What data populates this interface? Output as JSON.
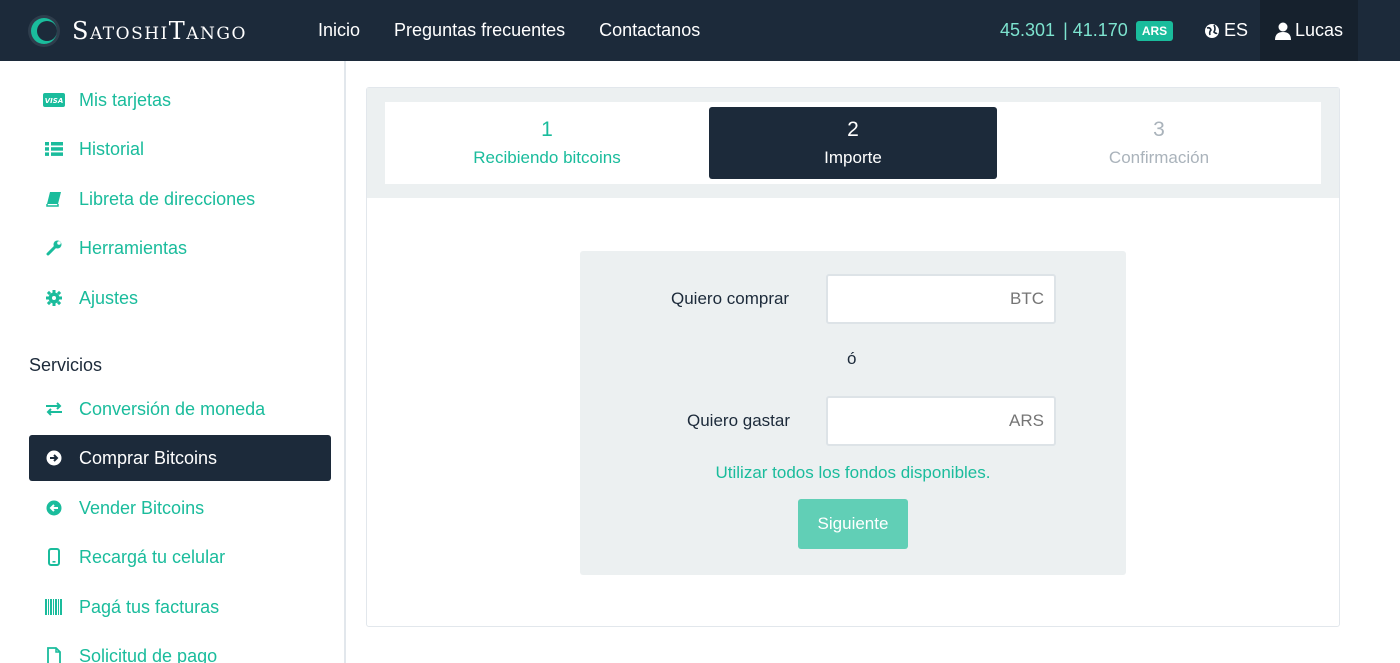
{
  "header": {
    "brand": "SatoshiTango",
    "nav": [
      "Inicio",
      "Preguntas frecuentes",
      "Contactanos"
    ],
    "rate_buy": "45.301",
    "rate_sep": "|",
    "rate_sell": "41.170",
    "currency_badge": "ARS",
    "language": "ES",
    "user": "Lucas"
  },
  "sidebar": {
    "items_top": [
      {
        "label": "Mis tarjetas",
        "icon": "visa-card-icon"
      },
      {
        "label": "Historial",
        "icon": "list-icon"
      },
      {
        "label": "Libreta de direcciones",
        "icon": "book-icon"
      },
      {
        "label": "Herramientas",
        "icon": "wrench-icon"
      },
      {
        "label": "Ajustes",
        "icon": "gear-icon"
      }
    ],
    "services_heading": "Servicios",
    "items_services": [
      {
        "label": "Conversión de moneda",
        "icon": "exchange-icon"
      },
      {
        "label": "Comprar Bitcoins",
        "icon": "arrow-right-circle-icon",
        "active": true
      },
      {
        "label": "Vender Bitcoins",
        "icon": "arrow-left-circle-icon"
      },
      {
        "label": "Recargá tu celular",
        "icon": "mobile-icon"
      },
      {
        "label": "Pagá tus facturas",
        "icon": "barcode-icon"
      },
      {
        "label": "Solicitud de pago",
        "icon": "document-icon"
      }
    ]
  },
  "steps": [
    {
      "num": "1",
      "label": "Recibiendo bitcoins",
      "state": "done"
    },
    {
      "num": "2",
      "label": "Importe",
      "state": "active"
    },
    {
      "num": "3",
      "label": "Confirmación",
      "state": "pending"
    }
  ],
  "form": {
    "buy_label": "Quiero comprar",
    "buy_placeholder": "BTC",
    "or_text": "ó",
    "spend_label": "Quiero gastar",
    "spend_placeholder": "ARS",
    "use_all_link": "Utilizar todos los fondos disponibles.",
    "next_button": "Siguiente"
  },
  "colors": {
    "navy": "#1c2a3a",
    "accent": "#1abc9c",
    "button_disabled": "#61cfb6",
    "panel_gray": "#ecf0f1"
  }
}
